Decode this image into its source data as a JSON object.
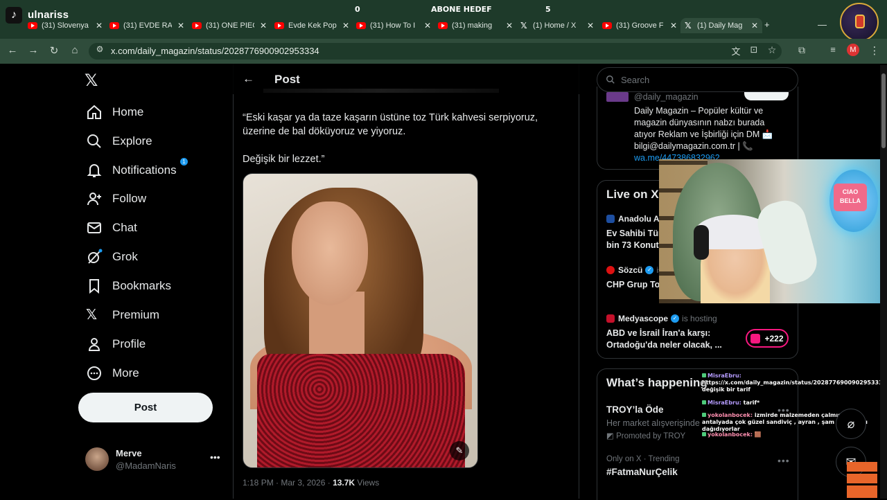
{
  "overlay": {
    "brand": "ulnariss",
    "goal_left": "0",
    "goal_title": "ABONE HEDEF",
    "goal_right": "5"
  },
  "tabs": [
    {
      "label": "(31) Slovenya",
      "icon": "youtube-icon"
    },
    {
      "label": "(31) EVDE RA",
      "icon": "youtube-icon"
    },
    {
      "label": "(31) ONE PIEC",
      "icon": "youtube-icon"
    },
    {
      "label": "Evde Kek Pop",
      "icon": "youtube-icon"
    },
    {
      "label": "(31) How To I",
      "icon": "youtube-icon"
    },
    {
      "label": "(31) making",
      "icon": "youtube-icon"
    },
    {
      "label": "(1) Home / X",
      "icon": "x-icon"
    },
    {
      "label": "(31) Groove F",
      "icon": "youtube-icon"
    },
    {
      "label": "(1) Daily Mag",
      "icon": "x-icon"
    }
  ],
  "browser": {
    "url": "x.com/daily_magazin/status/2028776900902953334",
    "profile_letter": "M"
  },
  "nav": {
    "items": [
      {
        "label": "Home",
        "icon": "home-icon"
      },
      {
        "label": "Explore",
        "icon": "search-icon"
      },
      {
        "label": "Notifications",
        "icon": "bell-icon",
        "badge": "1"
      },
      {
        "label": "Follow",
        "icon": "follow-icon"
      },
      {
        "label": "Chat",
        "icon": "mail-icon"
      },
      {
        "label": "Grok",
        "icon": "grok-icon"
      },
      {
        "label": "Bookmarks",
        "icon": "bookmark-icon"
      },
      {
        "label": "Premium",
        "icon": "x-logo-icon"
      },
      {
        "label": "Profile",
        "icon": "person-icon"
      },
      {
        "label": "More",
        "icon": "more-circle-icon"
      }
    ],
    "post_button": "Post",
    "account": {
      "name": "Merve",
      "handle": "@MadamNaris"
    }
  },
  "post": {
    "header_title": "Post",
    "text_1": "“Eski kaşar ya da taze kaşarın üstüne toz Türk kahvesi serpiyoruz, üzerine de bal döküyoruz ve yiyoruz.",
    "text_2": "Değişik bir lezzet.”",
    "meta": "1:18 PM · Mar 3, 2026 · ",
    "views_count": "13.7K",
    "views_label": " Views"
  },
  "right": {
    "search_placeholder": "Search",
    "profile_card": {
      "handle": "@daily_magazin",
      "bio": "Daily Magazin – Popüler kültür ve magazin dünyasının nabzı burada atıyor Reklam ve İşbirliği için DM 📩 bilgi@dailymagazin.com.tr | 📞",
      "link": "wa.me/447386832962"
    },
    "live": {
      "title": "Live on X",
      "rows": [
        {
          "source": "Anadolu Aj",
          "headline": "Ev Sahibi Tür\nbin 73 Konut"
        },
        {
          "source": "Sözcü",
          "hosting": "is",
          "headline": "CHP Grup To"
        },
        {
          "source": "Medyascope",
          "hosting": "is hosting",
          "headline": "ABD ve İsrail İran'a karşı: Ortadoğu'da neler olacak, ..."
        }
      ],
      "plus_count": "+222"
    },
    "happening": {
      "title": "What’s happening",
      "promo_title": "TROY’la Öde",
      "promo_sub": "Her market alışverişinde",
      "promo_by": "Promoted by TROY",
      "trend_meta": "Only on X · Trending",
      "trend_tag": "#FatmaNurÇelik"
    }
  },
  "chat": [
    {
      "user": "MisraEbru:",
      "text": "https://x.com/daily_magazin/status/2028776900902953334 değişik bir tarif"
    },
    {
      "user": "MisraEbru:",
      "text": "tarif*"
    },
    {
      "user": "yokolanbocek:",
      "text": "izmirde malzemeden çalmışlar . antalyada çok güzel sandiviç , ayran , şam tatlısı , su dağıdıyorlar"
    },
    {
      "user": "yokolanbocek:",
      "text": "🟫"
    }
  ],
  "webcam": {
    "sign_text": "CIAO BELLA"
  }
}
